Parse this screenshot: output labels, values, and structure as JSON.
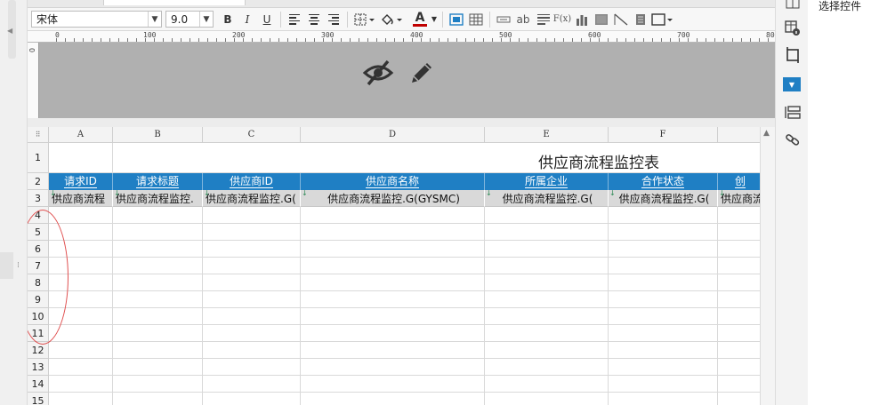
{
  "toolbar": {
    "font_name": "宋体",
    "font_size": "9.0",
    "bold_label": "B",
    "italic_label": "I",
    "underline_label": "U",
    "wrap_label": "ab",
    "formula_label": "F(x)",
    "font_color_label": "A",
    "font_color": "#c00000"
  },
  "ruler": {
    "labels": [
      "0",
      "100",
      "200",
      "300",
      "400",
      "500",
      "600",
      "700",
      "80"
    ],
    "vertical_label": "0"
  },
  "grid": {
    "columns": [
      "A",
      "B",
      "C",
      "D",
      "E",
      "F"
    ],
    "rows": [
      "1",
      "2",
      "3",
      "4",
      "5",
      "6",
      "7",
      "8",
      "9",
      "10",
      "11",
      "12",
      "13",
      "14",
      "15"
    ],
    "title": "供应商流程监控表",
    "headers": [
      "请求ID",
      "请求标题",
      "供应商ID",
      "供应商名称",
      "所属企业",
      "合作状态",
      "创"
    ],
    "data_row": [
      "供应商流程",
      "供应商流程监控.",
      "供应商流程监控.G(",
      "供应商流程监控.G(GYSMC)",
      "供应商流程监控.G(",
      "供应商流程监控.G(",
      "供应商流"
    ],
    "header_color": "#1f7fc4"
  },
  "right_panel": {
    "title": "选择控件"
  }
}
